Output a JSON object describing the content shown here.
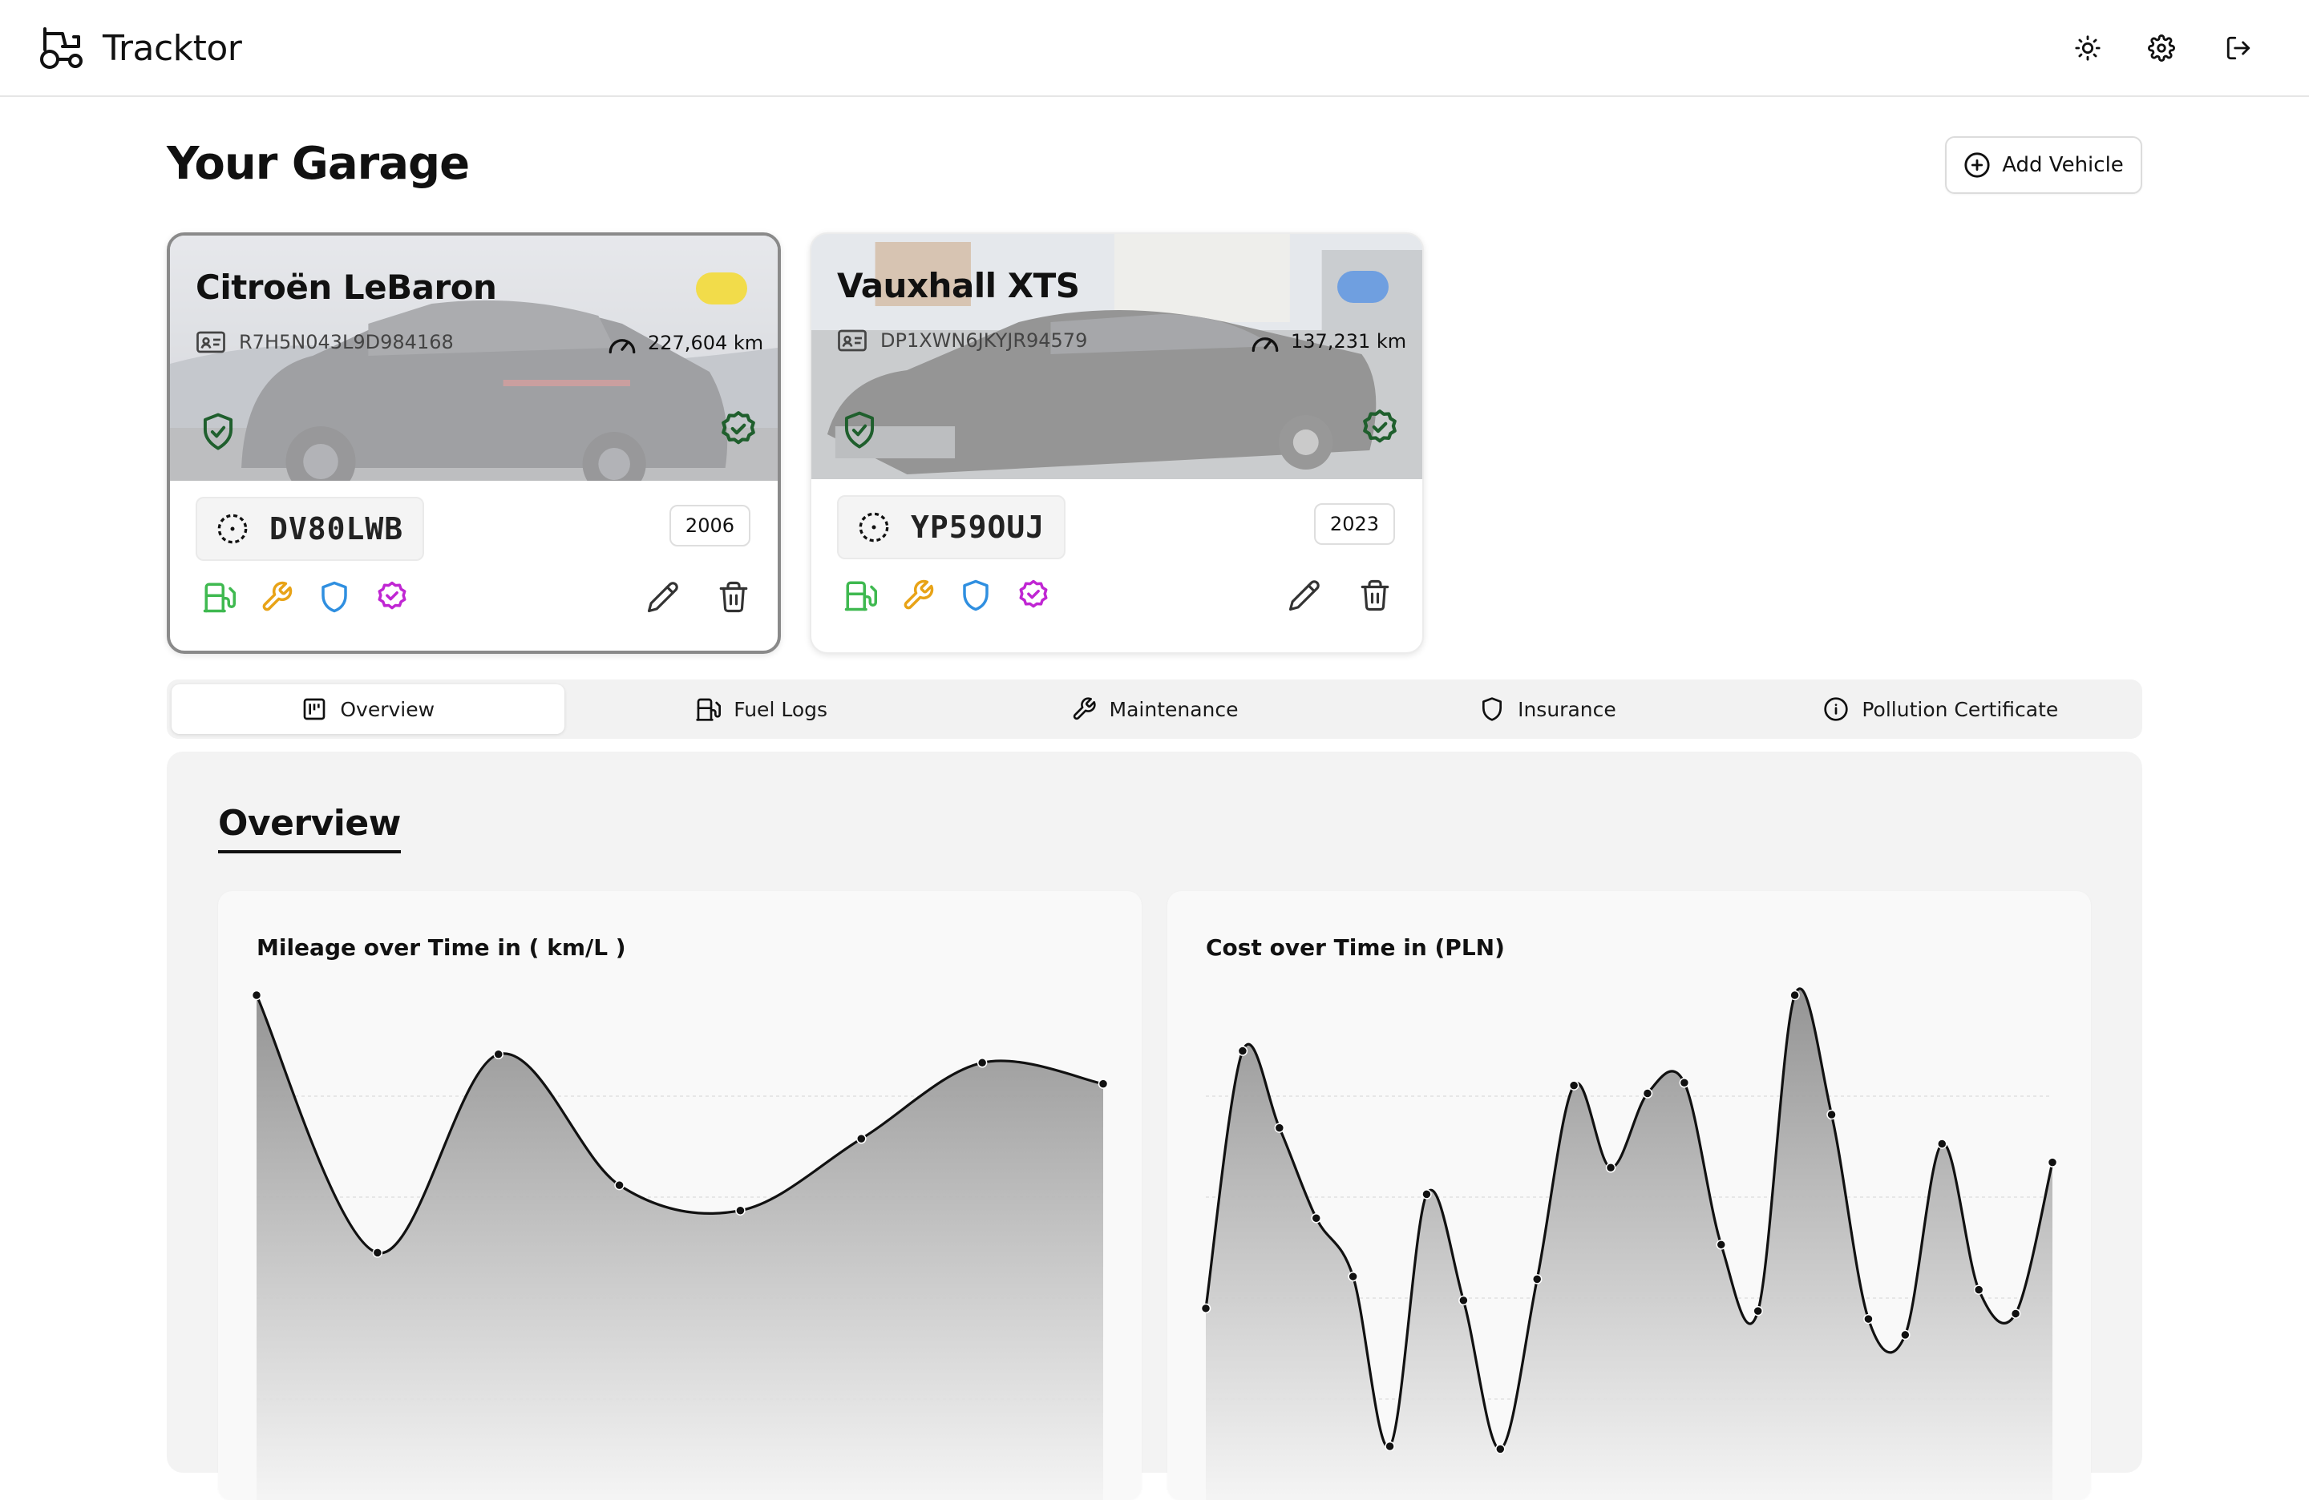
{
  "app": {
    "name": "Tracktor"
  },
  "header": {
    "icons": [
      "sun-icon",
      "gear-icon",
      "logout-icon"
    ]
  },
  "page": {
    "title": "Your Garage",
    "add_vehicle_label": "Add Vehicle"
  },
  "vehicles": [
    {
      "name": "Citroën LeBaron",
      "vin": "R7H5N043L9D984168",
      "odometer": "227,604 km",
      "plate": "DV80LWB",
      "year": "2006",
      "color": "#f2dc4a",
      "selected": true
    },
    {
      "name": "Vauxhall XTS",
      "vin": "DP1XWN6JKYJR94579",
      "odometer": "137,231 km",
      "plate": "YP59OUJ",
      "year": "2023",
      "color": "#6f9fe0",
      "selected": false
    }
  ],
  "tabs": [
    {
      "label": "Overview",
      "icon": "dashboard-icon",
      "active": true
    },
    {
      "label": "Fuel Logs",
      "icon": "fuel-icon",
      "active": false
    },
    {
      "label": "Maintenance",
      "icon": "wrench-icon",
      "active": false
    },
    {
      "label": "Insurance",
      "icon": "shield-icon",
      "active": false
    },
    {
      "label": "Pollution Certificate",
      "icon": "info-icon",
      "active": false
    }
  ],
  "overview": {
    "title": "Overview"
  },
  "colors": {
    "fuel": "#3fb950",
    "maintenance": "#e8a317",
    "insurance": "#2f8fe0",
    "pollution": "#c026d3",
    "status_ok": "#1f5f2d"
  },
  "chart_data": [
    {
      "type": "area",
      "title": "Mileage over Time in ( km/L )",
      "x": [
        0,
        1,
        2,
        3,
        4,
        5,
        6,
        7
      ],
      "values": [
        22.0,
        9.8,
        19.2,
        13.0,
        11.8,
        15.2,
        18.8,
        17.8
      ],
      "ylim": [
        0,
        22.0
      ],
      "grid": true
    },
    {
      "type": "area",
      "title": "Cost over Time in (PLN)",
      "x": [
        0,
        1,
        2,
        3,
        4,
        5,
        6,
        7,
        8,
        9,
        10,
        11,
        12,
        13,
        14,
        15,
        16,
        17,
        18,
        19,
        20,
        21,
        22,
        23
      ],
      "values": [
        570,
        1540,
        1250,
        910,
        690,
        50,
        1000,
        600,
        40,
        680,
        1410,
        1100,
        1380,
        1420,
        810,
        560,
        1750,
        1300,
        530,
        470,
        1190,
        640,
        550,
        1120
      ],
      "ylim": [
        0,
        1750
      ],
      "grid": true
    }
  ]
}
